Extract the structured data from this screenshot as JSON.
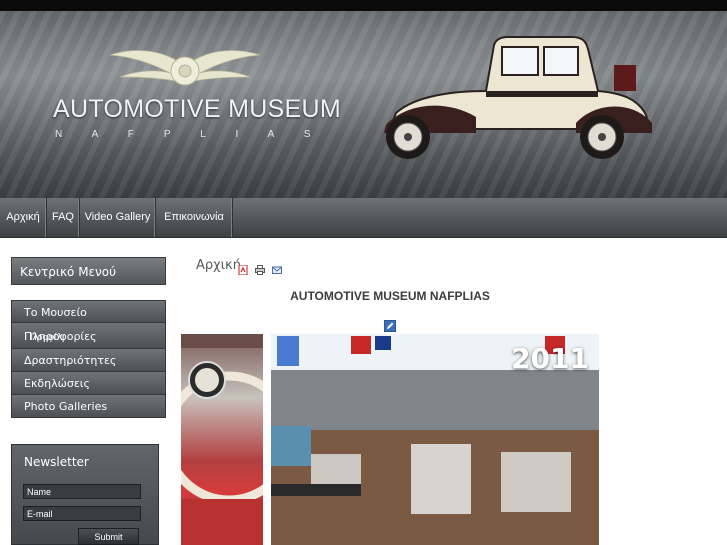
{
  "header": {
    "title": "AUTOMOTIVE MUSEUM",
    "subtitle": "N A F P L I A S"
  },
  "nav": {
    "items": [
      {
        "label": "Αρχική"
      },
      {
        "label": "FAQ"
      },
      {
        "label": "Video Gallery"
      },
      {
        "label": "Επικοινωνία"
      }
    ]
  },
  "sidebar": {
    "menu_title": "Κεντρικό Μενού",
    "items": [
      {
        "label": "Το Μουσείο"
      },
      {
        "label": "Πληροφορίες"
      },
      {
        "label": "Δραστηριότητες"
      },
      {
        "label": "Εκδηλώσεις"
      },
      {
        "label": "Photo Galleries"
      }
    ],
    "submenu_peek": "Προφίλ"
  },
  "newsletter": {
    "title": "Newsletter",
    "name_placeholder": "Name",
    "email_placeholder": "E-mail",
    "submit_label": "Submit"
  },
  "content": {
    "breadcrumb": "Αρχική",
    "article_title": "AUTOMOTIVE MUSEUM NAFPLIAS",
    "photo_year": "2011"
  },
  "icons": {
    "pdf": "pdf-icon",
    "print": "print-icon",
    "email": "email-icon",
    "edit": "edit-icon",
    "logo": "winged-wheel-logo-icon"
  },
  "colors": {
    "topbar": "#0a0a0a",
    "nav_bg": "#55595c",
    "menu_bg": "#5e6266",
    "text_dark": "#3a3d40"
  }
}
